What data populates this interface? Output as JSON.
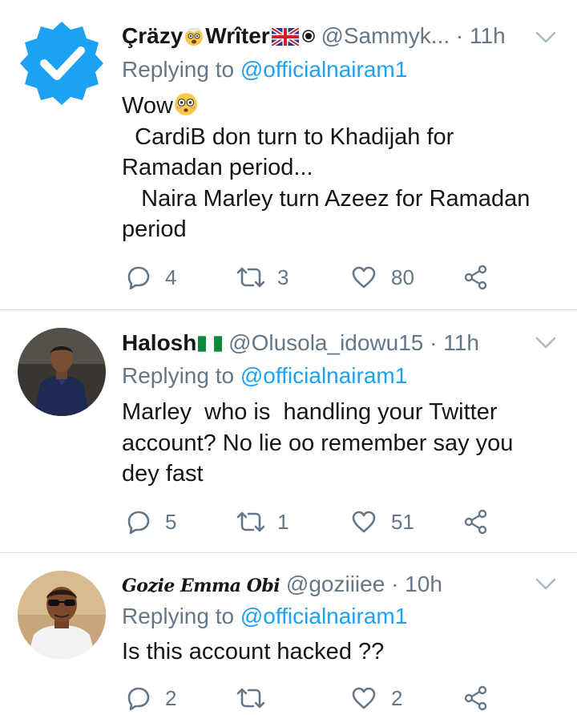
{
  "tweets": [
    {
      "name_parts": [
        "Çräzy",
        "Wrîter"
      ],
      "handle": "@Sammyk...",
      "time": "11h",
      "replying_label": "Replying to",
      "mention": "@officialnairam1",
      "body_line1": "Wow",
      "body_rest": "  CardiB don turn to Khadijah for\nRamadan period...\n   Naira Marley turn Azeez for Ramadan\nperiod",
      "replies": "4",
      "retweets": "3",
      "likes": "80"
    },
    {
      "name": "Halosh",
      "handle": "@Olusola_idowu15",
      "time": "11h",
      "replying_label": "Replying to",
      "mention": "@officialnairam1",
      "body": "Marley  who is  handling your Twitter\naccount? No lie oo remember say you\ndey fast",
      "replies": "5",
      "retweets": "1",
      "likes": "51"
    },
    {
      "name": "Gozie Emma Obi",
      "handle": "@goziiiee",
      "time": "10h",
      "replying_label": "Replying to",
      "mention": "@officialnairam1",
      "body": "Is this account hacked ??",
      "replies": "2",
      "retweets": "",
      "likes": "2"
    }
  ],
  "icons": {
    "verified": "verified-badge-icon",
    "reply": "reply-icon",
    "retweet": "retweet-icon",
    "like": "heart-icon",
    "share": "share-icon",
    "menu": "chevron-down-icon"
  },
  "colors": {
    "link": "#1da1f2",
    "secondary_text": "#657786",
    "divider": "#d9dfe3"
  }
}
